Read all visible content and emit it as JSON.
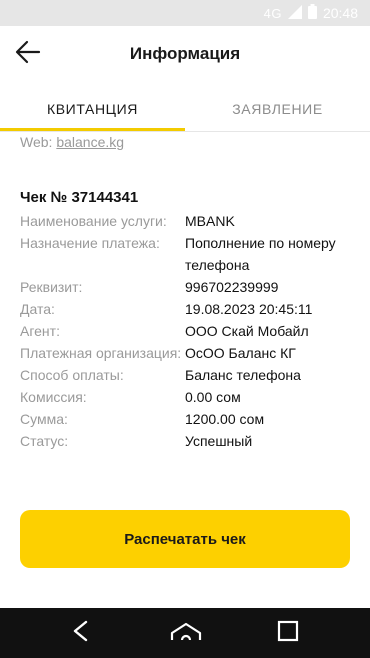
{
  "status_bar": {
    "network": "4G",
    "time": "20:48"
  },
  "app_bar": {
    "title": "Информация"
  },
  "tabs": [
    {
      "label": "КВИТАНЦИЯ",
      "active": true
    },
    {
      "label": "ЗАЯВЛЕНИЕ",
      "active": false
    }
  ],
  "web": {
    "label": "Web:",
    "link": "balance.kg"
  },
  "receipt": {
    "title": "Чек № 37144341",
    "rows": [
      {
        "key": "Наименование услуги:",
        "value": "MBANK"
      },
      {
        "key": "Назначение платежа:",
        "value": "Пополнение по номеру телефона"
      },
      {
        "key": "Реквизит:",
        "value": "996702239999"
      },
      {
        "key": "Дата:",
        "value": "19.08.2023 20:45:11"
      },
      {
        "key": "Агент:",
        "value": "ООО Скай Мобайл"
      },
      {
        "key": "Платежная организация:",
        "value": "ОсОО Баланс КГ"
      },
      {
        "key": "Способ оплаты:",
        "value": "Баланс телефона"
      },
      {
        "key": "Комиссия:",
        "value": "0.00 сом"
      },
      {
        "key": "Сумма:",
        "value": "1200.00 сом"
      },
      {
        "key": "Статус:",
        "value": "Успешный"
      }
    ]
  },
  "print_button": {
    "label": "Распечатать чек"
  },
  "colors": {
    "accent": "#fdd000",
    "tab_indicator": "#f3cb00",
    "muted_text": "#9a9a9a",
    "nav_bar": "#111111"
  },
  "icons": {
    "back": "arrow-left-icon",
    "nav_back": "triangle-back-icon",
    "nav_home": "home-icon",
    "nav_recents": "square-recents-icon",
    "signal": "signal-icon",
    "battery": "battery-icon"
  }
}
